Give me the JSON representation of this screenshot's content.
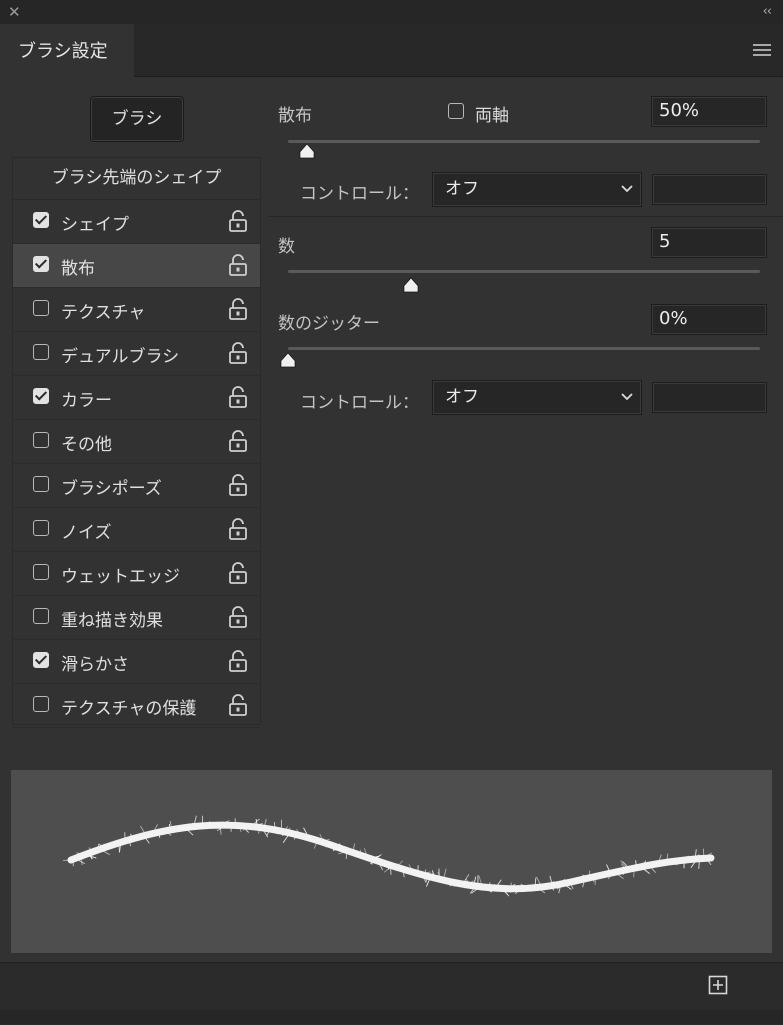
{
  "window": {
    "close_glyph": "✕",
    "collapse_glyph": "‹‹"
  },
  "panel": {
    "tab_title": "ブラシ設定",
    "menu_icon": "hamburger-menu-icon"
  },
  "brush_button_label": "ブラシ",
  "list": {
    "header": "ブラシ先端のシェイプ",
    "items": [
      {
        "label": "シェイプ",
        "checked": true,
        "selected": false
      },
      {
        "label": "散布",
        "checked": true,
        "selected": true
      },
      {
        "label": "テクスチャ",
        "checked": false,
        "selected": false
      },
      {
        "label": "デュアルブラシ",
        "checked": false,
        "selected": false
      },
      {
        "label": "カラー",
        "checked": true,
        "selected": false
      },
      {
        "label": "その他",
        "checked": false,
        "selected": false
      },
      {
        "label": "ブラシポーズ",
        "checked": false,
        "selected": false
      },
      {
        "label": "ノイズ",
        "checked": false,
        "selected": false
      },
      {
        "label": "ウェットエッジ",
        "checked": false,
        "selected": false
      },
      {
        "label": "重ね描き効果",
        "checked": false,
        "selected": false
      },
      {
        "label": "滑らかさ",
        "checked": true,
        "selected": false
      },
      {
        "label": "テクスチャの保護",
        "checked": false,
        "selected": false
      }
    ]
  },
  "scatter": {
    "label": "散布",
    "both_axes_label": "両軸",
    "both_axes_checked": false,
    "value": "50%",
    "slider_fraction": 0.04,
    "control_label": "コントロール：",
    "control_value": "オフ",
    "control_field": ""
  },
  "count": {
    "label": "数",
    "value": "5",
    "slider_fraction": 0.26
  },
  "count_jitter": {
    "label": "数のジッター",
    "value": "0%",
    "slider_fraction": 0.0,
    "control_label": "コントロール：",
    "control_value": "オフ",
    "control_field": ""
  },
  "colors": {
    "panel_bg": "#323232",
    "field_bg": "#262626",
    "preview_bg": "#4e4e4e",
    "stroke": "#f2f2f2"
  }
}
